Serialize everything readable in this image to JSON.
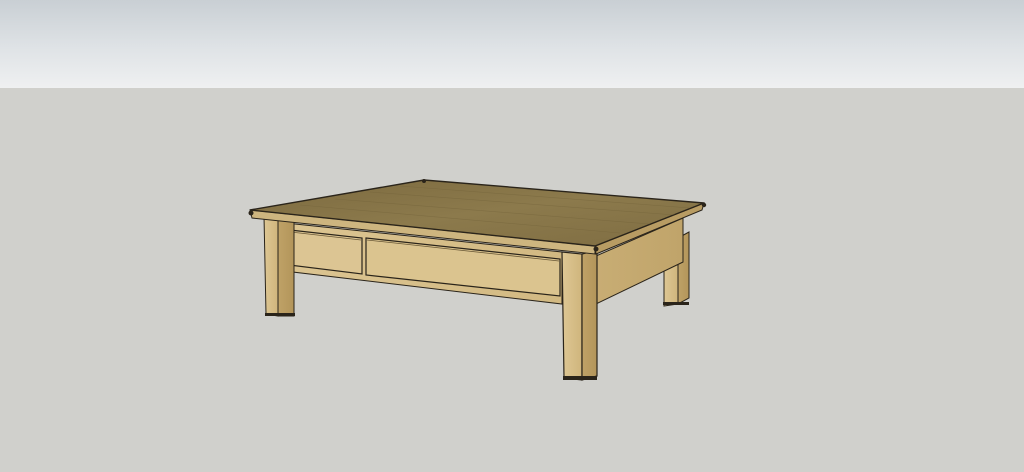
{
  "viewport": {
    "sky_color_top": "#c9cfd4",
    "sky_color_bottom": "#eff0f1",
    "ground_color": "#d0d0cc"
  },
  "model": {
    "object": "coffee-table",
    "top_color": "#8a7749",
    "wood_light": "#d9c28e",
    "wood_mid": "#c9ad72",
    "wood_dark": "#b89a60",
    "edge_color": "#2a241a"
  }
}
